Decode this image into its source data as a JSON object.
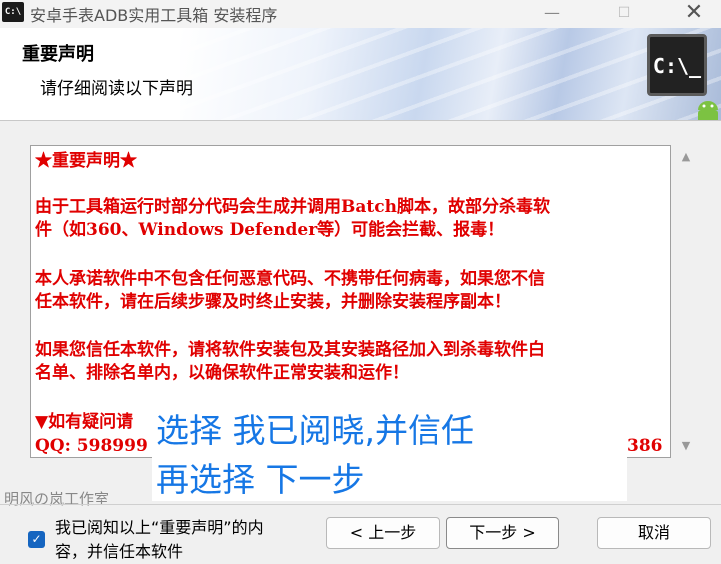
{
  "window": {
    "title": "安卓手表ADB实用工具箱 安装程序",
    "app_icon_text": "C:\\",
    "minimize": "—",
    "maximize": "☐",
    "close": "✕"
  },
  "header": {
    "title": "重要声明",
    "subtitle": "请仔细阅读以下声明",
    "cmd_icon_text": "C:\\_"
  },
  "notice": {
    "title": "★重要声明★",
    "para1_line1": "由于工具箱运行时部分代码会生成并调用Batch脚本，故部分杀毒软",
    "para1_line2": "件（如360、Windows Defender等）可能会拦截、报毒！",
    "para2_line1": "本人承诺软件中不包含任何恶意代码、不携带任何病毒，如果您不信",
    "para2_line2": "任本软件，请在后续步骤及时终止安装，并删除安装程序副本！",
    "para3_line1": "如果您信任本软件，请将软件安装包及其安装路径加入到杀毒软件白",
    "para3_line2": "名单、排除名单内，以确保软件正常安装和运作！",
    "para4_line1": "▼如有疑问请",
    "para4_qq": "QQ: 598999",
    "para4_tail": "386"
  },
  "scrollbar": {
    "up": "▲",
    "down": "▼"
  },
  "overlay": {
    "line1": "选择 我已阅晓,并信任",
    "line2": "再选择 下一步"
  },
  "footer": {
    "studio": "明风の岚工作室",
    "checkbox_checked": true,
    "checkbox_mark": "✓",
    "checkbox_label": "我已阅知以上“重要声明”的内容，并信任本软件",
    "back_button": "< 上一步",
    "next_button": "下一步 >",
    "cancel_button": "取消"
  },
  "colors": {
    "notice_text": "#e00000",
    "overlay_text": "#1677e5",
    "checkbox": "#1565c0"
  }
}
